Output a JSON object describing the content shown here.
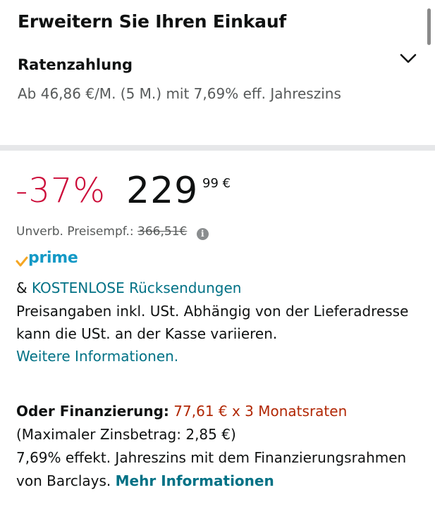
{
  "header": {
    "title": "Erweitern Sie Ihren Einkauf"
  },
  "installment": {
    "title": "Ratenzahlung",
    "description": "Ab 46,86 €/M. (5 M.) mit 7,69% eff. Jahreszins",
    "expand_icon": "chevron-down-icon"
  },
  "price": {
    "discount": "-37%",
    "whole": "229",
    "fraction": "99 €",
    "list_price_label": "Unverb. Preisempf.:",
    "list_price_value": "366,51€",
    "info_icon": "info-icon"
  },
  "prime": {
    "label": "prime",
    "check_color": "#f5a623",
    "text_color": "#1399c6"
  },
  "returns": {
    "prefix": "&",
    "link": "KOSTENLOSE Rücksendungen"
  },
  "vat": {
    "text": "Preisangaben inkl. USt. Abhängig von der Lieferadresse kann die USt. an der Kasse variieren.",
    "link": "Weitere Informationen."
  },
  "financing": {
    "label": "Oder Finanzierung:",
    "rate": "77,61 € x 3 Monatsraten",
    "max_interest": "(Maximaler Zinsbetrag: 2,85 €)",
    "details": "7,69% effekt. Jahreszins mit dem Finanzierungsrahmen von Barclays.",
    "link": "Mehr Informationen"
  },
  "colors": {
    "discount": "#cc0c39",
    "link": "#007185",
    "financing_rate": "#b12704",
    "divider": "#e6e7e9"
  }
}
